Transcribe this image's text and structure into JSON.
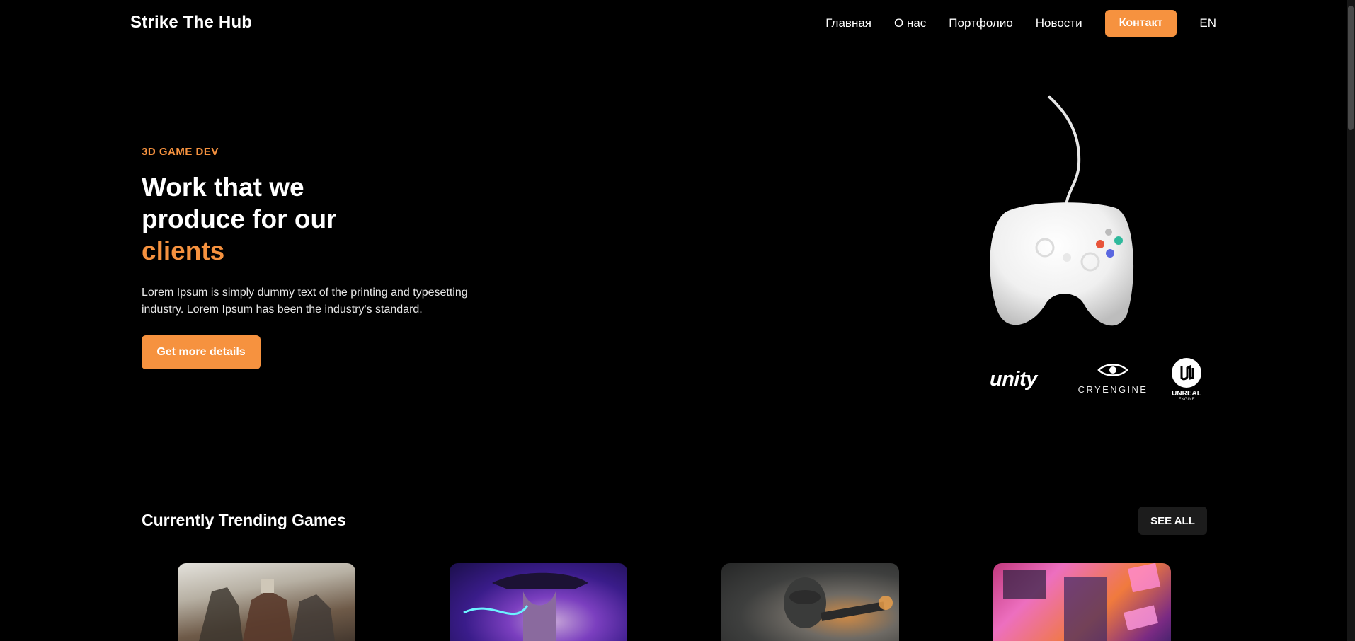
{
  "brand": {
    "name": "Strike The Hub"
  },
  "nav": {
    "items": [
      "Главная",
      "О нас",
      "Портфолио",
      "Новости"
    ],
    "contact_label": "Контакт",
    "lang_label": "EN"
  },
  "hero": {
    "eyebrow": "3D GAME DEV",
    "headline_line1": "Work that we",
    "headline_line2": "produce for our",
    "headline_accent": "clients",
    "lede": "Lorem Ipsum is simply dummy text of the printing and typesetting industry. Lorem Ipsum has been the industry's standard.",
    "cta_label": "Get more details"
  },
  "engines": {
    "unity": "unity",
    "cry": "CRYENGINE",
    "unreal_line1": "UNREAL",
    "unreal_line2": "ENGINE"
  },
  "trending": {
    "title": "Currently Trending Games",
    "see_all_label": "SEE ALL",
    "cards": [
      {
        "icon": "for-honor-image"
      },
      {
        "icon": "akali-image"
      },
      {
        "icon": "crysis-image"
      },
      {
        "icon": "neon-city-image"
      }
    ]
  },
  "colors": {
    "accent": "#f6923f",
    "background": "#000000",
    "button_dark": "#1c1c1c"
  }
}
